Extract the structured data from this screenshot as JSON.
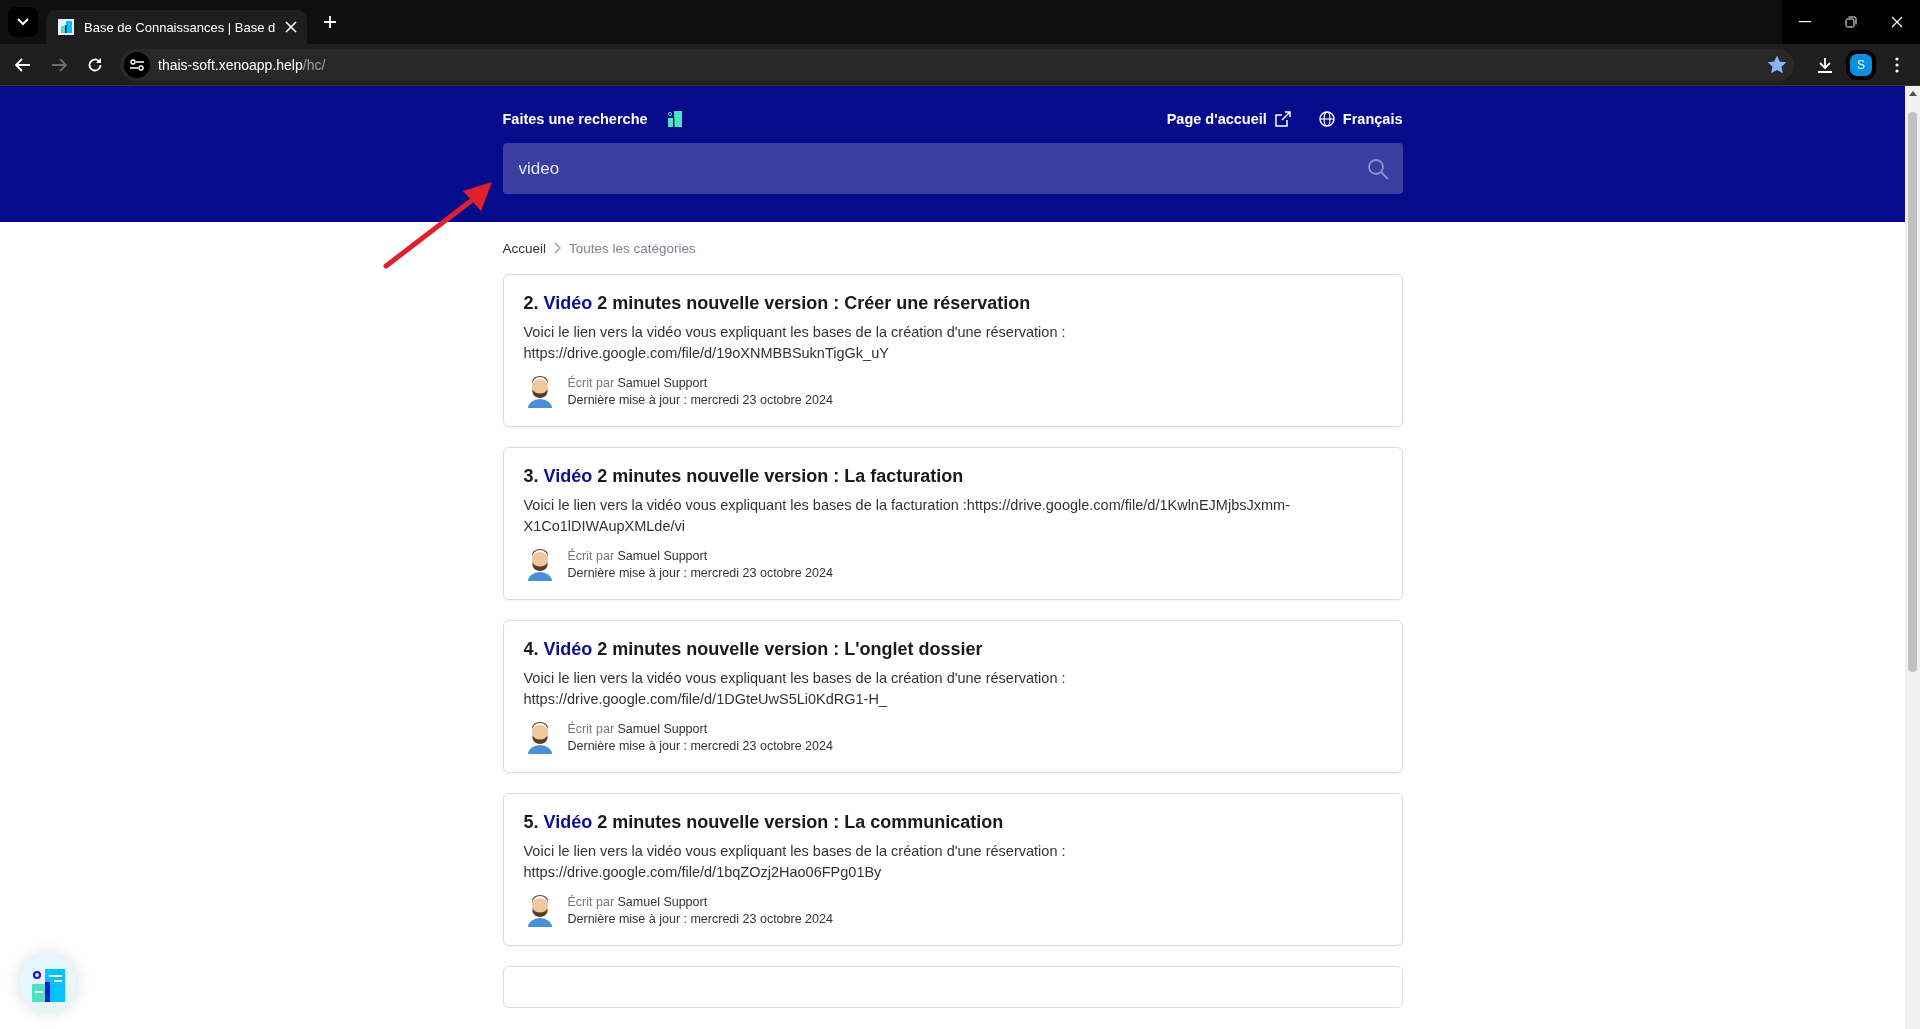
{
  "browser": {
    "tab": {
      "title": "Base de Connaissances | Base d",
      "selected": true
    },
    "url": {
      "host": "thais-soft.xenoapp.help",
      "path": "/hc/"
    },
    "forward_disabled": true,
    "bookmarked": true,
    "profile_initial": "S"
  },
  "header": {
    "search_label": "Faites une recherche",
    "home_link": "Page d'accueil",
    "language": "Français",
    "search": {
      "value": "video"
    }
  },
  "breadcrumb": [
    {
      "label": "Accueil"
    },
    {
      "label": "Toutes les catégories"
    }
  ],
  "articles": [
    {
      "title": [
        {
          "text": "2. ",
          "highlight": false
        },
        {
          "text": "Vidéo",
          "highlight": true
        },
        {
          "text": " 2 minutes nouvelle version : Créer une réservation",
          "highlight": false
        }
      ],
      "excerpt": "Voici le lien vers la vidéo vous expliquant les bases de la création d'une réservation : https://drive.google.com/file/d/19oXNMBBSuknTigGk_uY",
      "author_label": "Écrit par",
      "author": "Samuel Support",
      "updated": "Dernière mise à jour : mercredi 23 octobre 2024"
    },
    {
      "title": [
        {
          "text": "3. ",
          "highlight": false
        },
        {
          "text": "Vidéo",
          "highlight": true
        },
        {
          "text": " 2 minutes nouvelle version : La facturation",
          "highlight": false
        }
      ],
      "excerpt": "Voici le lien vers la vidéo vous expliquant les bases de la facturation :https://drive.google.com/file/d/1KwlnEJMjbsJxmm-X1Co1lDIWAupXMLde/vi",
      "author_label": "Écrit par",
      "author": "Samuel Support",
      "updated": "Dernière mise à jour : mercredi 23 octobre 2024"
    },
    {
      "title": [
        {
          "text": "4. ",
          "highlight": false
        },
        {
          "text": "Vidéo",
          "highlight": true
        },
        {
          "text": " 2 minutes nouvelle version : L'onglet dossier",
          "highlight": false
        }
      ],
      "excerpt": "Voici le lien vers la vidéo vous expliquant les bases de la création d'une réservation : https://drive.google.com/file/d/1DGteUwS5Li0KdRG1-H_",
      "author_label": "Écrit par",
      "author": "Samuel Support",
      "updated": "Dernière mise à jour : mercredi 23 octobre 2024"
    },
    {
      "title": [
        {
          "text": "5. ",
          "highlight": false
        },
        {
          "text": "Vidéo",
          "highlight": true
        },
        {
          "text": " 2 minutes nouvelle version : La communication",
          "highlight": false
        }
      ],
      "excerpt": "Voici le lien vers la vidéo vous expliquant les bases de la création d'une réservation : https://drive.google.com/file/d/1bqZOzj2Hao06FPg01By",
      "author_label": "Écrit par",
      "author": "Samuel Support",
      "updated": "Dernière mise à jour : mercredi 23 octobre 2024"
    }
  ]
}
